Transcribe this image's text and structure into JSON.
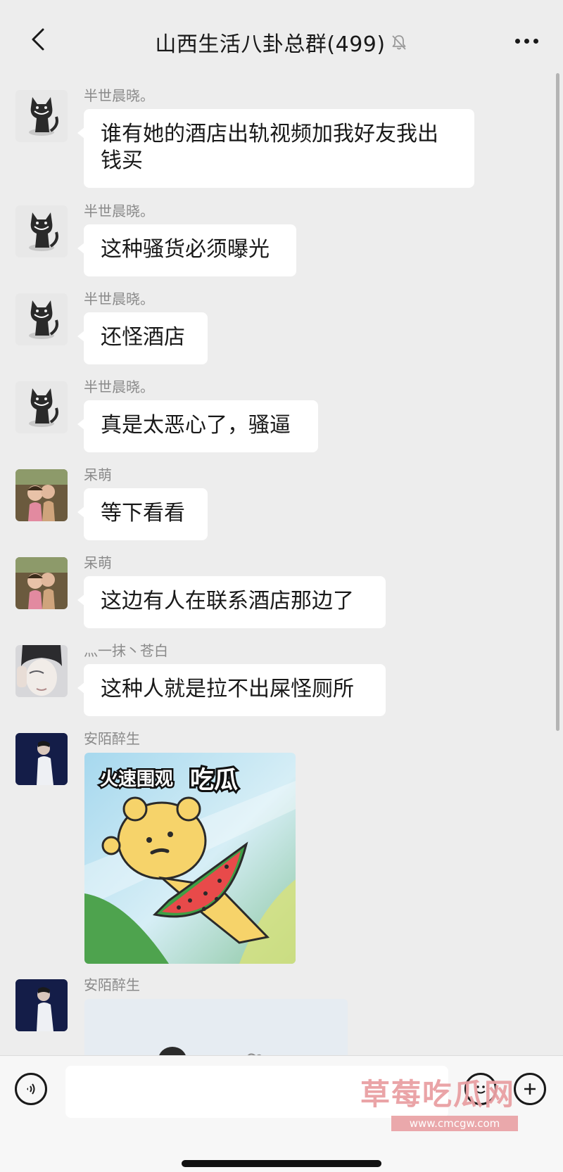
{
  "header": {
    "title": "山西生活八卦总群(499)",
    "back_icon": "chevron-left-icon",
    "mute_icon": "bell-muted-icon",
    "more_icon": "more-dots-icon"
  },
  "messages": [
    {
      "sender": "半世晨晓。",
      "avatar": "black-cat",
      "text_lines": [
        "谁有她的酒店出轨视频加我好友我出",
        "钱买"
      ]
    },
    {
      "sender": "半世晨晓。",
      "avatar": "black-cat",
      "text": "这种骚货必须曝光"
    },
    {
      "sender": "半世晨晓。",
      "avatar": "black-cat",
      "text": "还怪酒店"
    },
    {
      "sender": "半世晨晓。",
      "avatar": "black-cat",
      "text": "真是太恶心了，骚逼"
    },
    {
      "sender": "呆萌",
      "avatar": "kids-photo",
      "text": "等下看看"
    },
    {
      "sender": "呆萌",
      "avatar": "kids-photo",
      "text": "这边有人在联系酒店那边了"
    },
    {
      "sender": "灬一抹丶苍白",
      "avatar": "face-photo",
      "text": "这种人就是拉不出屎怪厕所"
    },
    {
      "sender": "安陌醉生",
      "avatar": "man-photo",
      "sticker_caption_1": "火速围观",
      "sticker_caption_2": "吃瓜"
    },
    {
      "sender": "安陌醉生",
      "avatar": "man-photo",
      "image": "photo"
    }
  ],
  "input_bar": {
    "voice_icon": "voice-icon",
    "emoji_icon": "emoji-icon",
    "plus_icon": "plus-icon",
    "value": ""
  },
  "watermark": {
    "text": "草莓吃瓜网",
    "url": "www.cmcgw.com"
  }
}
